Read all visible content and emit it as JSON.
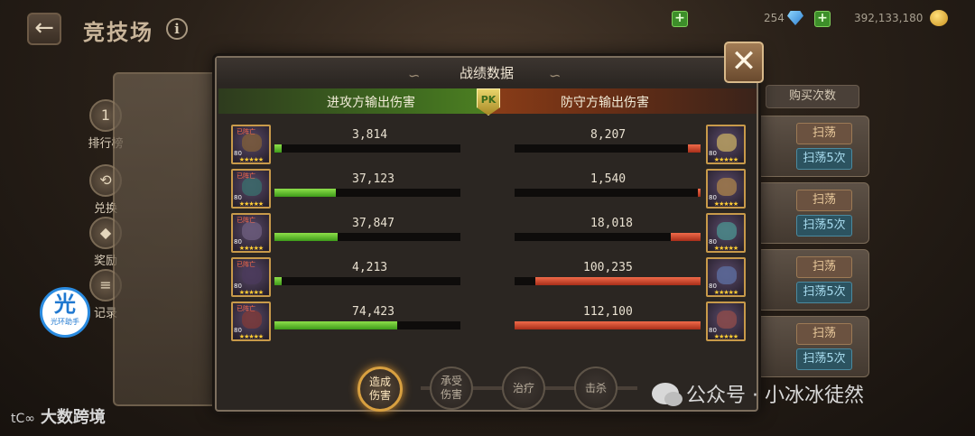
{
  "header": {
    "back_symbol": "←",
    "title": "竞技场",
    "info_symbol": "i",
    "gems": "254",
    "coins": "392,133,180",
    "plus_symbol": "+"
  },
  "side_menu": [
    {
      "icon": "1",
      "label": "排行榜"
    },
    {
      "icon": "⟲",
      "label": "兑换"
    },
    {
      "icon": "◆",
      "label": "奖励"
    },
    {
      "icon": "≡",
      "label": "记录"
    }
  ],
  "assistant": {
    "big": "光",
    "small": "光环助手"
  },
  "right_panel": {
    "buy_label": "购买次数",
    "rows": [
      {
        "sweep": "扫荡",
        "sweep5": "扫荡5次"
      },
      {
        "sweep": "扫荡",
        "sweep5": "扫荡5次"
      },
      {
        "sweep": "扫荡",
        "sweep5": "扫荡5次"
      },
      {
        "sweep": "扫荡",
        "sweep5": "扫荡5次"
      }
    ]
  },
  "modal": {
    "title": "战绩数据",
    "close_symbol": "✕",
    "attacker_label": "进攻方输出伤害",
    "defender_label": "防守方输出伤害",
    "pk_label": "PK",
    "attackers": [
      {
        "value": "3,814",
        "ratio": 0.04,
        "level": "80",
        "stars": "★★★★★",
        "dead": "已阵亡"
      },
      {
        "value": "37,123",
        "ratio": 0.33,
        "level": "80",
        "stars": "★★★★★",
        "dead": "已阵亡"
      },
      {
        "value": "37,847",
        "ratio": 0.34,
        "level": "80",
        "stars": "★★★★★",
        "dead": "已阵亡"
      },
      {
        "value": "4,213",
        "ratio": 0.04,
        "level": "80",
        "stars": "★★★★★",
        "dead": "已阵亡"
      },
      {
        "value": "74,423",
        "ratio": 0.66,
        "level": "80",
        "stars": "★★★★★",
        "dead": "已阵亡"
      }
    ],
    "defenders": [
      {
        "value": "8,207",
        "ratio": 0.07,
        "level": "80",
        "stars": "★★★★★"
      },
      {
        "value": "1,540",
        "ratio": 0.014,
        "level": "80",
        "stars": "★★★★★"
      },
      {
        "value": "18,018",
        "ratio": 0.16,
        "level": "80",
        "stars": "★★★★★"
      },
      {
        "value": "100,235",
        "ratio": 0.89,
        "level": "80",
        "stars": "★★★★★"
      },
      {
        "value": "112,100",
        "ratio": 1.0,
        "level": "80",
        "stars": "★★★★★"
      }
    ],
    "tabs": [
      {
        "label": "造成伤害",
        "active": true
      },
      {
        "label": "承受伤害",
        "active": false
      },
      {
        "label": "治疗",
        "active": false
      },
      {
        "label": "击杀",
        "active": false
      }
    ]
  },
  "watermarks": {
    "left_logo": "tC∞",
    "left_text": "大数跨境",
    "right_text": "公众号 · 小冰冰徒然"
  }
}
